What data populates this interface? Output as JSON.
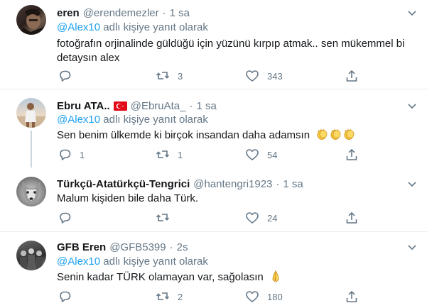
{
  "tweets": [
    {
      "name": "eren",
      "handle": "@erendemezler",
      "dot": "·",
      "time": "1 sa",
      "reply_mention": "@Alex10",
      "reply_suffix": " adlı kişiye yanıt olarak",
      "text_line1": "fotoğrafın orjinalinde güldüğü için yüzünü kırpıp atmak.. sen mükemmel bi",
      "text_line2": "detaysın alex",
      "replies": "",
      "retweets": "3",
      "likes": "343"
    },
    {
      "name": "Ebru ATA..",
      "handle": "@EbruAta_",
      "dot": "·",
      "time": "1 sa",
      "reply_mention": "@Alex10",
      "reply_suffix": " adlı kişiye yanıt olarak",
      "text_line1": "Sen benim ülkemde ki birçok insandan daha adamsın",
      "replies": "1",
      "retweets": "1",
      "likes": "54"
    },
    {
      "name": "Türkçü-Atatürkçü-Tengrici",
      "handle": "@hantengri1923",
      "dot": "·",
      "time": "1 sa",
      "text_line1": "Malum kişiden bile daha Türk.",
      "replies": "",
      "retweets": "",
      "likes": "24"
    },
    {
      "name": "GFB Eren",
      "handle": "@GFB5399",
      "dot": "·",
      "time": "2s",
      "reply_mention": "@Alex10",
      "reply_suffix": " adlı kişiye yanıt olarak",
      "text_line1": "Senin kadar TÜRK olamayan var, sağolasın",
      "replies": "",
      "retweets": "2",
      "likes": "180"
    }
  ],
  "icons": {
    "reply": "reply-icon",
    "retweet": "retweet-icon",
    "like": "like-icon",
    "share": "share-icon",
    "caret": "chevron-down-icon",
    "clap": "clapping-hands-emoji",
    "pray": "folded-hands-emoji",
    "flag": "turkey-flag-emoji"
  },
  "colors": {
    "text": "#14171a",
    "secondary": "#657786",
    "link": "#1da1f2",
    "divider": "#e6ecf0",
    "thread_line": "#ccd6dd",
    "flag_red": "#e30a17"
  }
}
